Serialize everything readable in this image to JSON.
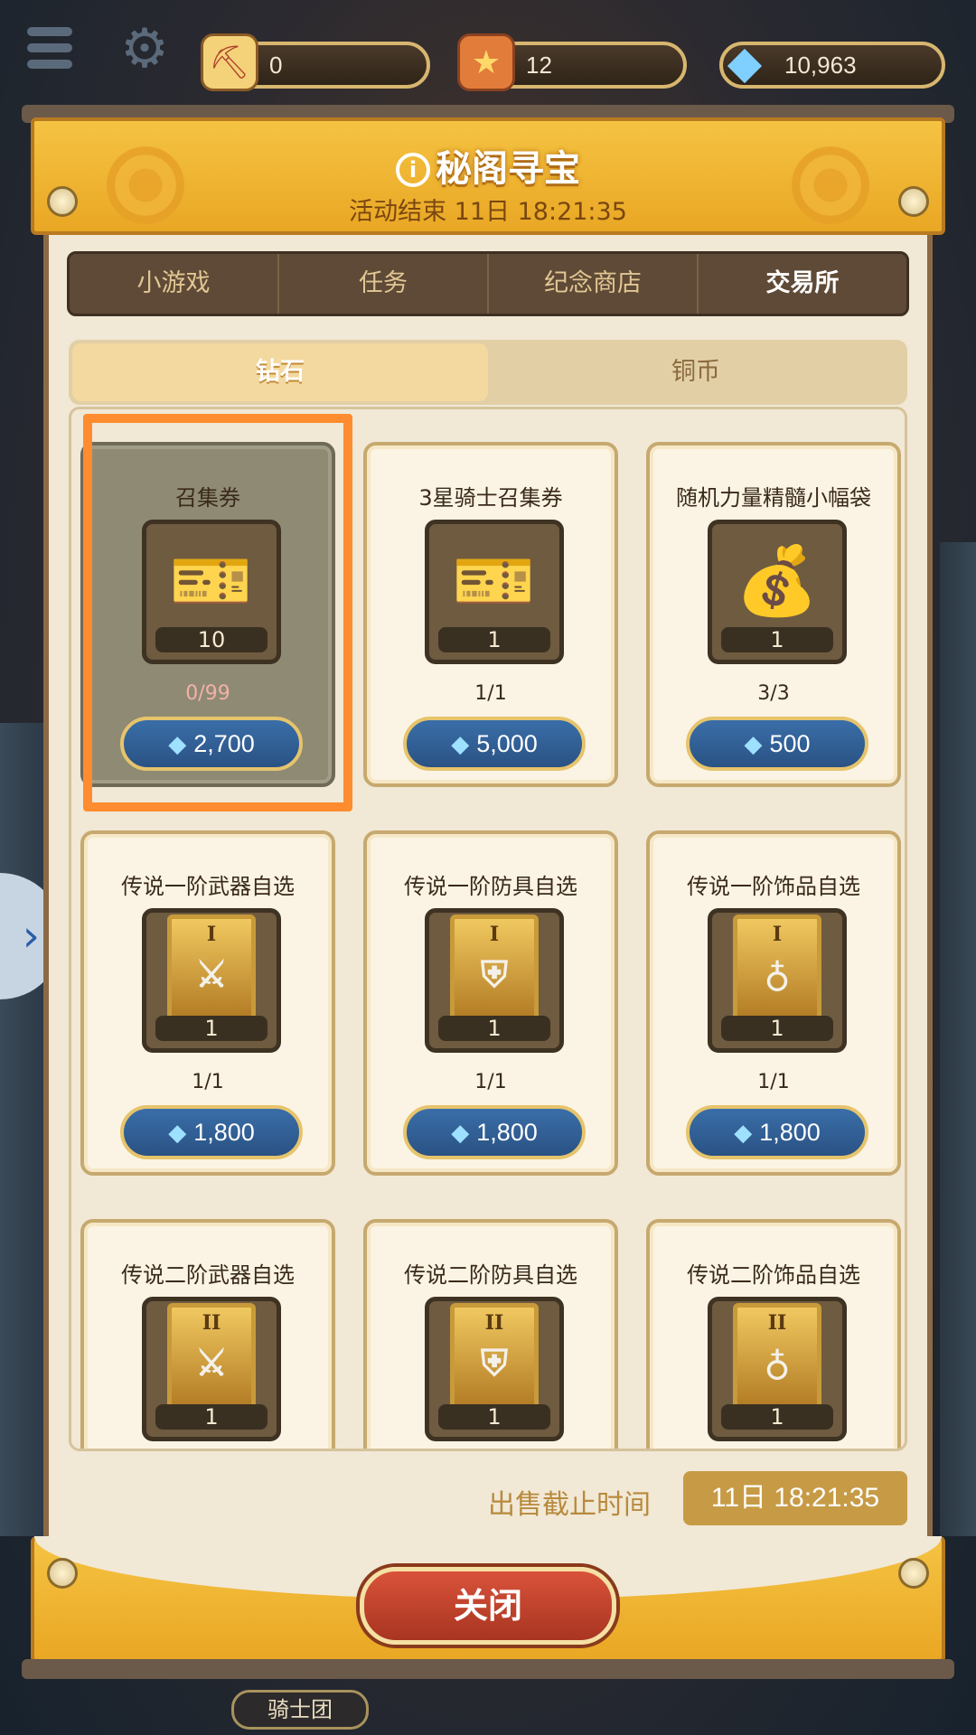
{
  "hud": {
    "shovel_count": "0",
    "ticket_count": "12",
    "diamond_count": "10,963"
  },
  "panel": {
    "title": "秘阁寻宝",
    "subtitle": "活动结束 11日 18:21:35"
  },
  "tabs": [
    {
      "label": "小游戏"
    },
    {
      "label": "任务"
    },
    {
      "label": "纪念商店"
    },
    {
      "label": "交易所"
    }
  ],
  "active_tab": "交易所",
  "currency_tabs": [
    {
      "label": "钻石"
    },
    {
      "label": "铜币"
    }
  ],
  "active_currency_tab": "钻石",
  "items": [
    {
      "name": "召集券",
      "qty": "10",
      "limit": "0/99",
      "price": "2,700",
      "icon": "ticket-icon"
    },
    {
      "name": "3星骑士召集券",
      "qty": "1",
      "limit": "1/1",
      "price": "5,000",
      "icon": "gold-ticket-icon"
    },
    {
      "name": "随机力量精髓小幅袋",
      "qty": "1",
      "limit": "3/3",
      "price": "500",
      "icon": "pouch-icon"
    },
    {
      "name": "传说一阶武器自选",
      "qty": "1",
      "limit": "1/1",
      "price": "1,800",
      "icon": "weapon-relic-icon",
      "tier": "I"
    },
    {
      "name": "传说一阶防具自选",
      "qty": "1",
      "limit": "1/1",
      "price": "1,800",
      "icon": "armor-relic-icon",
      "tier": "I"
    },
    {
      "name": "传说一阶饰品自选",
      "qty": "1",
      "limit": "1/1",
      "price": "1,800",
      "icon": "accessory-relic-icon",
      "tier": "I"
    },
    {
      "name": "传说二阶武器自选",
      "qty": "1",
      "icon": "weapon-relic-icon",
      "tier": "II"
    },
    {
      "name": "传说二阶防具自选",
      "qty": "1",
      "icon": "armor-relic-icon",
      "tier": "II"
    },
    {
      "name": "传说二阶饰品自选",
      "qty": "1",
      "icon": "accessory-relic-icon",
      "tier": "II"
    }
  ],
  "deadline": {
    "label": "出售截止时间",
    "value": "11日  18:21:35"
  },
  "close_label": "关闭",
  "bottom_label": "骑士团",
  "colors": {
    "panel_gold": "#f5c342",
    "highlight": "#ff8c2e",
    "price_blue": "#2a5284"
  }
}
